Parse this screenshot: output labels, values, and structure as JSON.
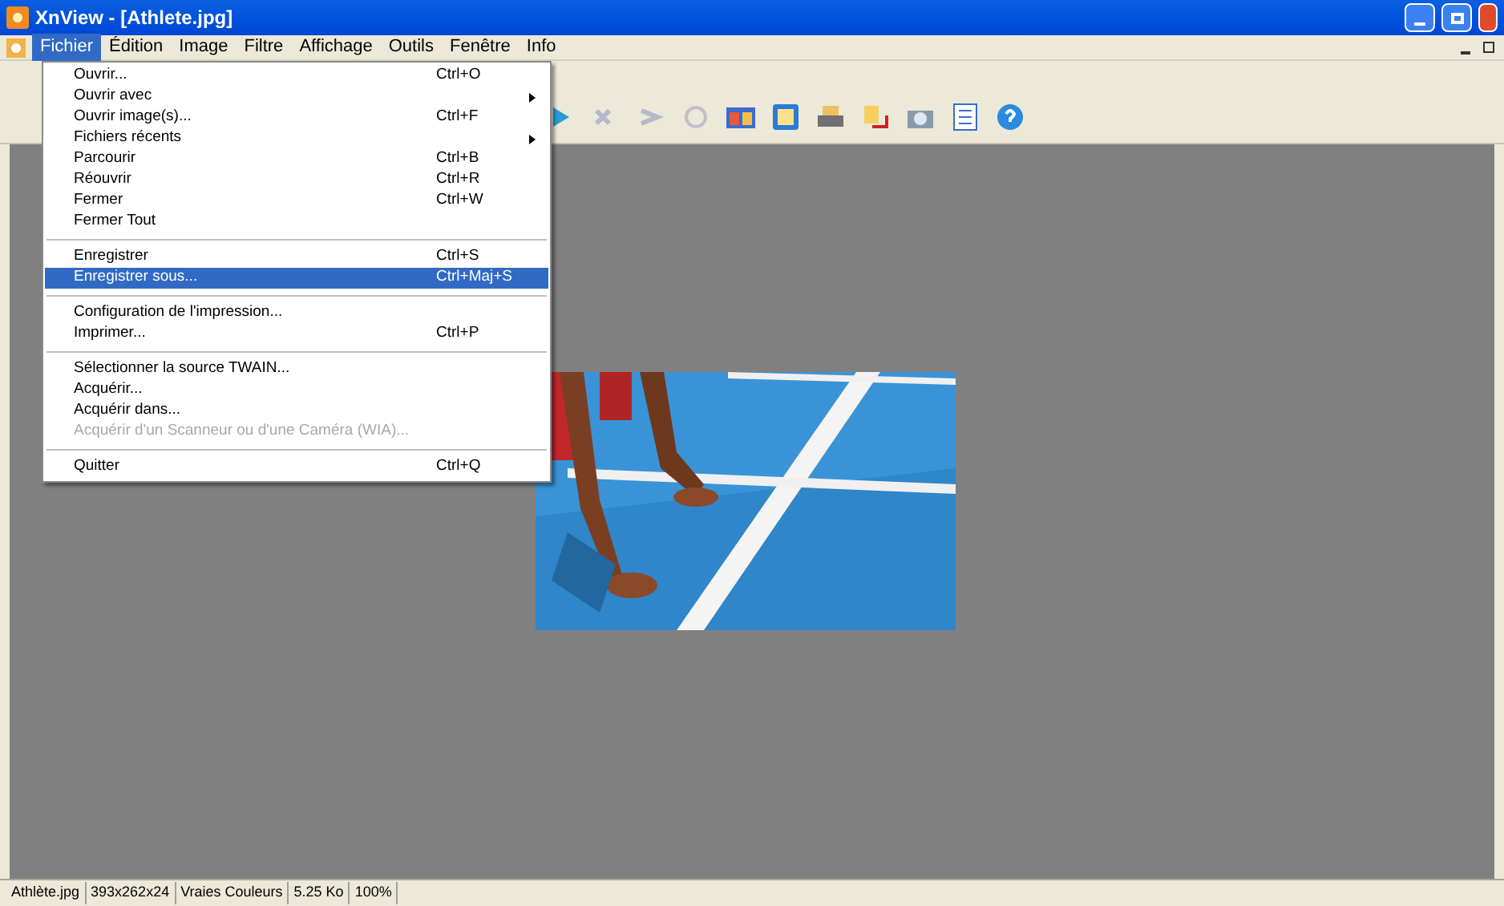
{
  "window": {
    "title": "XnView - [Athlete.jpg]"
  },
  "menubar": [
    {
      "label": "Fichier",
      "selected": true
    },
    {
      "label": "Édition",
      "selected": false
    },
    {
      "label": "Image",
      "selected": false
    },
    {
      "label": "Filtre",
      "selected": false
    },
    {
      "label": "Affichage",
      "selected": false
    },
    {
      "label": "Outils",
      "selected": false
    },
    {
      "label": "Fenêtre",
      "selected": false
    },
    {
      "label": "Info",
      "selected": false
    }
  ],
  "menu": [
    {
      "kind": "item",
      "label": "Ouvrir...",
      "shortcut": "Ctrl+O",
      "submenu": false,
      "selected": false,
      "disabled": false
    },
    {
      "kind": "item",
      "label": "Ouvrir avec",
      "submenu": true,
      "selected": false,
      "disabled": false
    },
    {
      "kind": "item",
      "label": "Ouvrir image(s)...",
      "shortcut": "Ctrl+F",
      "submenu": false,
      "selected": false,
      "disabled": false
    },
    {
      "kind": "item",
      "label": "Fichiers récents",
      "submenu": true,
      "selected": false,
      "disabled": false
    },
    {
      "kind": "item",
      "label": "Parcourir",
      "shortcut": "Ctrl+B",
      "submenu": false,
      "selected": false,
      "disabled": false
    },
    {
      "kind": "item",
      "label": "Réouvrir",
      "shortcut": "Ctrl+R",
      "submenu": false,
      "selected": false,
      "disabled": false
    },
    {
      "kind": "item",
      "label": "Fermer",
      "shortcut": "Ctrl+W",
      "submenu": false,
      "selected": false,
      "disabled": false
    },
    {
      "kind": "item",
      "label": "Fermer Tout",
      "submenu": false,
      "selected": false,
      "disabled": false
    },
    {
      "kind": "separator"
    },
    {
      "kind": "item",
      "label": "Enregistrer",
      "shortcut": "Ctrl+S",
      "submenu": false,
      "selected": false,
      "disabled": false
    },
    {
      "kind": "item",
      "label": "Enregistrer sous...",
      "shortcut": "Ctrl+Maj+S",
      "submenu": false,
      "selected": true,
      "disabled": false
    },
    {
      "kind": "separator"
    },
    {
      "kind": "item",
      "label": "Configuration de l'impression...",
      "submenu": false,
      "selected": false,
      "disabled": false
    },
    {
      "kind": "item",
      "label": "Imprimer...",
      "shortcut": "Ctrl+P",
      "submenu": false,
      "selected": false,
      "disabled": false
    },
    {
      "kind": "separator"
    },
    {
      "kind": "item",
      "label": "Sélectionner la source TWAIN...",
      "submenu": false,
      "selected": false,
      "disabled": false
    },
    {
      "kind": "item",
      "label": "Acquérir...",
      "submenu": false,
      "selected": false,
      "disabled": false
    },
    {
      "kind": "item",
      "label": "Acquérir dans...",
      "submenu": false,
      "selected": false,
      "disabled": false
    },
    {
      "kind": "item",
      "label": "Acquérir d'un Scanneur ou d'une Caméra (WIA)...",
      "submenu": false,
      "selected": false,
      "disabled": true
    },
    {
      "kind": "separator"
    },
    {
      "kind": "item",
      "label": "Quitter",
      "shortcut": "Ctrl+Q",
      "submenu": false,
      "selected": false,
      "disabled": false
    }
  ],
  "status_bar": [
    "Athlète.jpg",
    "393x262x24",
    "Vraies Couleurs",
    "5.25 Ko",
    "100%"
  ]
}
